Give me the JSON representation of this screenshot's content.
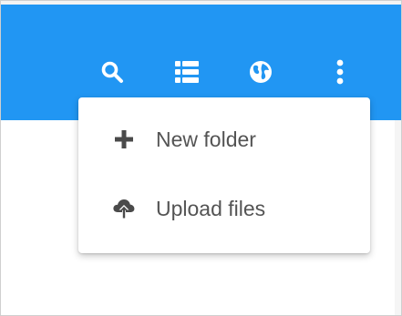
{
  "colors": {
    "appbar": "#2196f3",
    "icon_on_appbar": "#ffffff",
    "menu_text": "#545454",
    "menu_icon": "#4a4a4a"
  },
  "toolbar": {
    "buttons": [
      {
        "icon": "search-icon"
      },
      {
        "icon": "list-view-icon"
      },
      {
        "icon": "globe-icon"
      },
      {
        "icon": "more-vert-icon"
      }
    ]
  },
  "menu": {
    "items": [
      {
        "icon": "plus-icon",
        "label": "New folder"
      },
      {
        "icon": "cloud-upload-icon",
        "label": "Upload files"
      }
    ]
  }
}
